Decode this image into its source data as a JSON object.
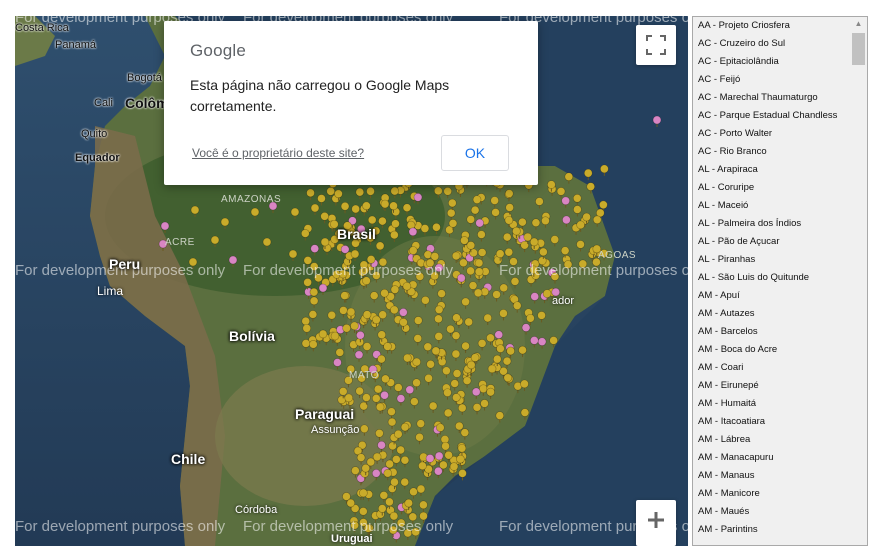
{
  "map": {
    "watermark": "For development purposes only",
    "labels": {
      "costa_rica": "Costa Rica",
      "panama": "Panamá",
      "bogota": "Bogotá",
      "cali": "Cali",
      "colombia": "Colôm",
      "quito": "Quito",
      "equador": "Equador",
      "amazonas": "AMAZONAS",
      "acre": "ACRE",
      "brasil": "Brasil",
      "peru": "Peru",
      "lima": "Lima",
      "bolivia": "Bolívia",
      "mato_grosso": "MATO",
      "paraguai": "Paraguai",
      "assuncao": "Assunção",
      "chile": "Chile",
      "cordoba": "Córdoba",
      "uruguai": "Uruguai",
      "alagoas": "AGOAS",
      "salvador": "ador"
    },
    "marker_colors": {
      "gold": "#c9ab2a",
      "pink": "#d985c3"
    }
  },
  "dialog": {
    "logo": "Google",
    "message": "Esta página não carregou o Google Maps corretamente.",
    "owner_link": "Você é o proprietário deste site?",
    "ok_label": "OK"
  },
  "controls": {
    "fullscreen_icon": "fullscreen-icon",
    "zoom_in_icon": "plus-icon"
  },
  "list": {
    "items": [
      "AA - Projeto Criosfera",
      "AC - Cruzeiro do Sul",
      "AC - Epitaciolândia",
      "AC - Feijó",
      "AC - Marechal Thaumaturgo",
      "AC - Parque Estadual Chandless",
      "AC - Porto Walter",
      "AC - Rio Branco",
      "AL - Arapiraca",
      "AL - Coruripe",
      "AL - Maceió",
      "AL - Palmeira dos Índios",
      "AL - Pão de Açucar",
      "AL - Piranhas",
      "AL - São Luis do Quitunde",
      "AM - Apuí",
      "AM - Autazes",
      "AM - Barcelos",
      "AM - Boca do Acre",
      "AM - Coari",
      "AM - Eirunepé",
      "AM - Humaitá",
      "AM - Itacoatiara",
      "AM - Lábrea",
      "AM - Manacapuru",
      "AM - Manaus",
      "AM - Manicore",
      "AM - Maués",
      "AM - Parintins"
    ]
  }
}
